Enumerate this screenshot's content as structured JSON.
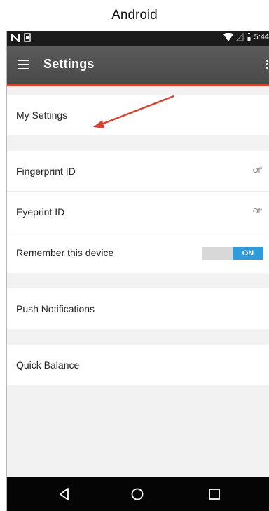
{
  "caption": "Android",
  "status_bar": {
    "time": "5:44",
    "icons": [
      "notification-n-icon",
      "sim-icon",
      "wifi-icon",
      "no-signal-icon",
      "battery-icon"
    ]
  },
  "app_bar": {
    "title": "Settings",
    "icons": [
      "menu-icon",
      "overflow-menu-icon"
    ],
    "accent_color": "#d9412d"
  },
  "settings": {
    "my_settings": "My Settings",
    "fingerprint": {
      "label": "Fingerprint ID",
      "value": "Off"
    },
    "eyeprint": {
      "label": "Eyeprint ID",
      "value": "Off"
    },
    "remember": {
      "label": "Remember this device",
      "toggle": "ON",
      "toggle_color": "#2f9bd8"
    },
    "push": "Push Notifications",
    "quick_balance": "Quick Balance"
  },
  "annotation": {
    "arrow_color": "#d9412d"
  },
  "nav_bar": {
    "icons": [
      "back-icon",
      "home-icon",
      "recents-icon"
    ]
  }
}
